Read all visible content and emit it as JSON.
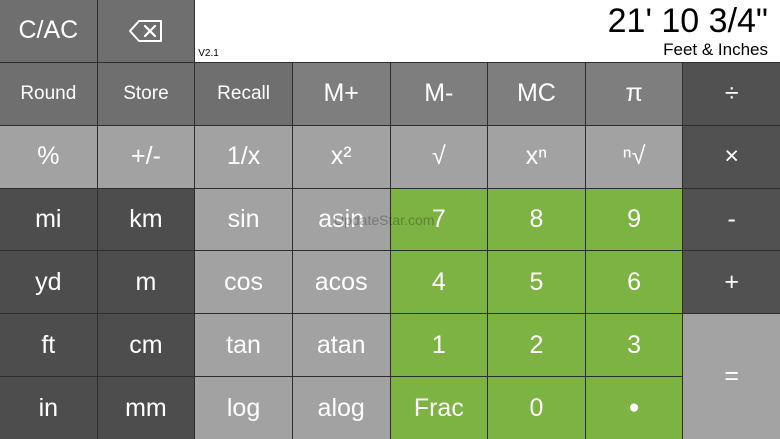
{
  "display": {
    "value": "21' 10 3/4\"",
    "unit": "Feet & Inches",
    "version": "V2.1"
  },
  "watermark": "UpdateStar.com",
  "keys": {
    "clear": "C/AC",
    "backspace_icon": "backspace-icon",
    "round": "Round",
    "store": "Store",
    "recall": "Recall",
    "m_plus": "M+",
    "m_minus": "M-",
    "mc": "MC",
    "pi": "π",
    "divide": "÷",
    "percent": "%",
    "plus_minus": "+/-",
    "reciprocal": "1/x",
    "square": "x²",
    "sqrt": "√",
    "power": "xⁿ",
    "nth_root": "ⁿ√",
    "multiply": "×",
    "mi": "mi",
    "km": "km",
    "sin": "sin",
    "asin": "asin",
    "seven": "7",
    "eight": "8",
    "nine": "9",
    "minus": "-",
    "yd": "yd",
    "m": "m",
    "cos": "cos",
    "acos": "acos",
    "four": "4",
    "five": "5",
    "six": "6",
    "plus": "+",
    "ft": "ft",
    "cm": "cm",
    "tan": "tan",
    "atan": "atan",
    "one": "1",
    "two": "2",
    "three": "3",
    "equals": "=",
    "inch": "in",
    "mm": "mm",
    "log": "log",
    "alog": "alog",
    "frac": "Frac",
    "zero": "0",
    "dot": "●"
  },
  "colors": {
    "display_bg": "#ffffff",
    "green": "#7cb342",
    "dark": "#4d4d4d",
    "light": "#a2a2a2"
  }
}
